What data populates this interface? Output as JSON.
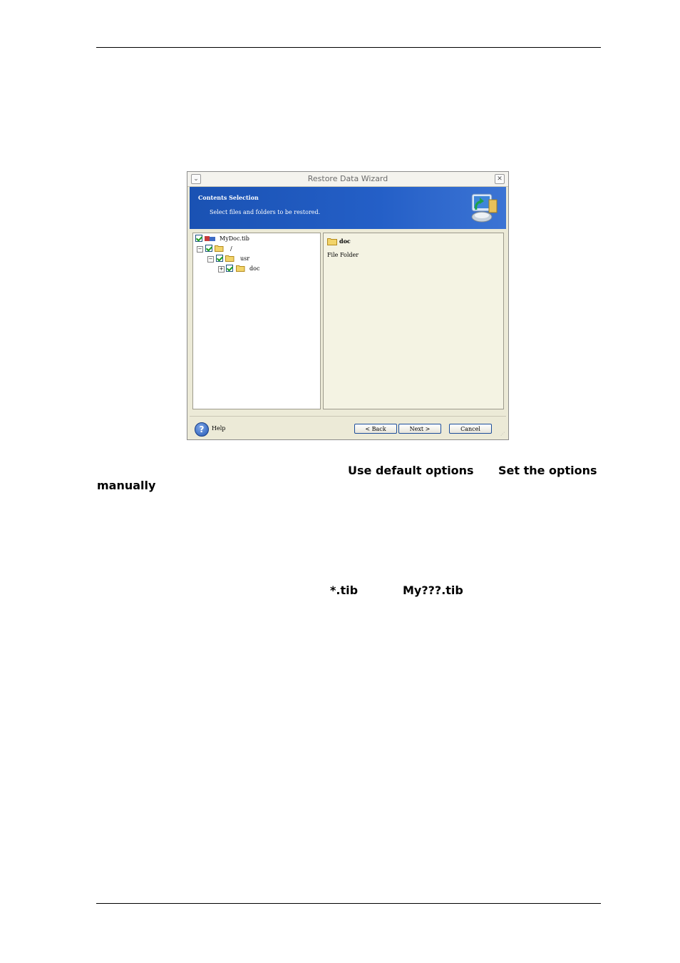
{
  "dialog": {
    "title": "Restore Data Wizard",
    "banner_heading": "Contents Selection",
    "banner_subtitle": "Select files and folders to be restored.",
    "tree": [
      {
        "label": "MyDoc.tib"
      },
      {
        "label": "/"
      },
      {
        "label": "usr"
      },
      {
        "label": "doc"
      }
    ],
    "details": {
      "name": "doc",
      "type": "File Folder"
    },
    "help_label": "Help",
    "back_label": "< Back",
    "next_label": "Next >",
    "cancel_label": "Cancel",
    "menu_icon": "chevron-down-icon",
    "close_icon": "close-icon"
  },
  "body": {
    "option1": "Use default options",
    "option2_part1": "Set the options",
    "option2_part2": "manually",
    "mask1": "*.tib",
    "mask2": "My???.tib"
  }
}
